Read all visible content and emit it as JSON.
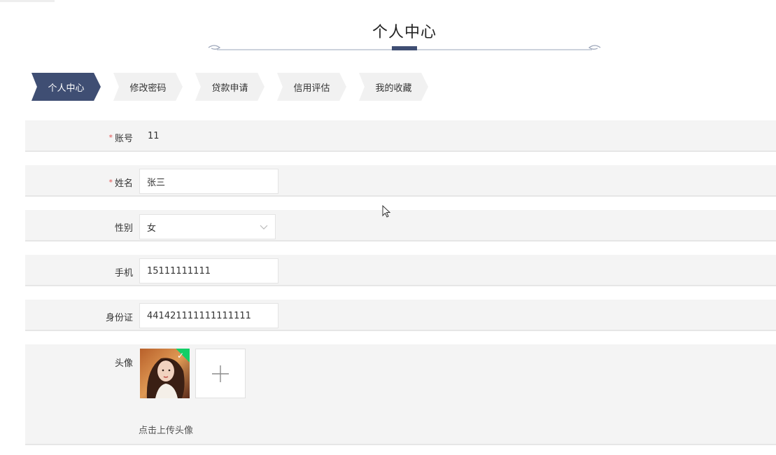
{
  "header": {
    "title": "个人中心"
  },
  "tabs": [
    {
      "label": "个人中心",
      "active": true
    },
    {
      "label": "修改密码",
      "active": false
    },
    {
      "label": "贷款申请",
      "active": false
    },
    {
      "label": "信用评估",
      "active": false
    },
    {
      "label": "我的收藏",
      "active": false
    }
  ],
  "form": {
    "account": {
      "label": "账号",
      "required_mark": "*",
      "value": "11"
    },
    "name": {
      "label": "姓名",
      "required_mark": "*",
      "value": "张三"
    },
    "gender": {
      "label": "性别",
      "value": "女"
    },
    "phone": {
      "label": "手机",
      "value": "15111111111"
    },
    "id_card": {
      "label": "身份证",
      "value": "441421111111111111"
    },
    "avatar": {
      "label": "头像",
      "upload_hint": "点击上传头像"
    }
  },
  "colors": {
    "accent": "#3f4e73",
    "required": "#e0504f",
    "success": "#13ce66",
    "row_bg": "#f4f4f4"
  },
  "icons": {
    "select": "chevron-down-icon",
    "upload": "plus-icon",
    "uploaded": "check-icon",
    "cursor": "cursor-icon"
  }
}
